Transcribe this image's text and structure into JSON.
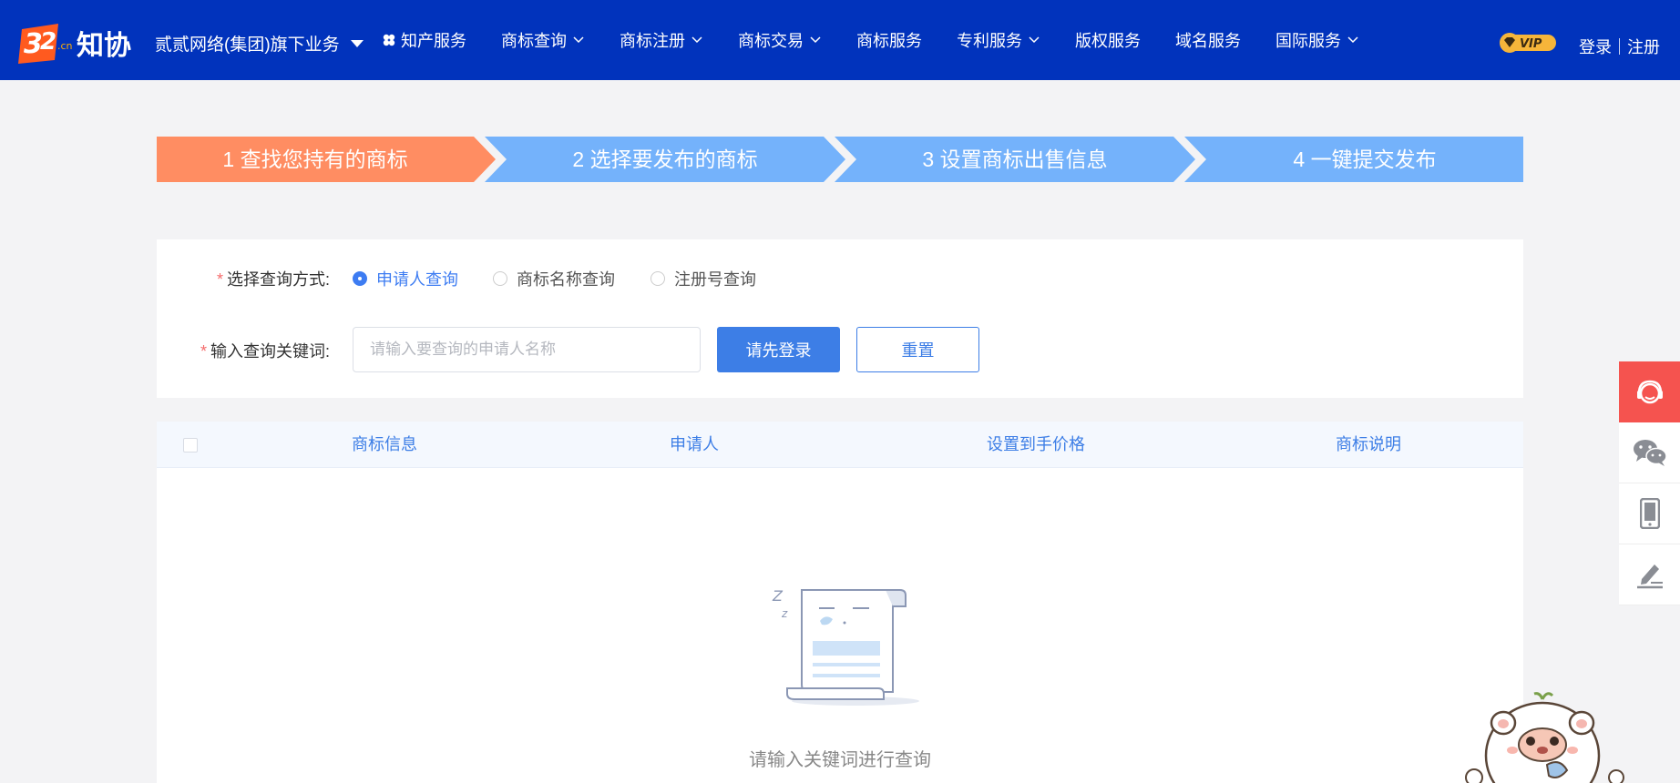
{
  "header": {
    "logo_text": "32.cn知协",
    "business_label": "贰贰网络(集团)旗下业务",
    "nav": [
      {
        "label": "知产服务",
        "icon": "clover-icon",
        "dropdown": false
      },
      {
        "label": "商标查询",
        "dropdown": true
      },
      {
        "label": "商标注册",
        "dropdown": true
      },
      {
        "label": "商标交易",
        "dropdown": true
      },
      {
        "label": "商标服务",
        "dropdown": false
      },
      {
        "label": "专利服务",
        "dropdown": true
      },
      {
        "label": "版权服务",
        "dropdown": false
      },
      {
        "label": "域名服务",
        "dropdown": false
      },
      {
        "label": "国际服务",
        "dropdown": true
      }
    ],
    "vip_label": "VIP",
    "login_label": "登录",
    "register_label": "注册"
  },
  "steps": [
    {
      "label": "1 查找您持有的商标",
      "active": true
    },
    {
      "label": "2 选择要发布的商标",
      "active": false
    },
    {
      "label": "3 设置商标出售信息",
      "active": false
    },
    {
      "label": "4 一键提交发布",
      "active": false
    }
  ],
  "form": {
    "query_mode_label": "选择查询方式:",
    "query_modes": [
      "申请人查询",
      "商标名称查询",
      "注册号查询"
    ],
    "selected_mode": "申请人查询",
    "keyword_label": "输入查询关键词:",
    "keyword_placeholder": "请输入要查询的申请人名称",
    "keyword_value": "",
    "submit_label": "请先登录",
    "reset_label": "重置"
  },
  "table": {
    "columns": [
      "商标信息",
      "申请人",
      "设置到手价格",
      "商标说明"
    ],
    "rows": [],
    "empty_text": "请输入关键词进行查询"
  },
  "sidebar": {
    "items": [
      "customer-service-icon",
      "wechat-icon",
      "mobile-icon",
      "feedback-icon"
    ]
  },
  "colors": {
    "header_bg": "#0133bc",
    "step_active": "#ff8d62",
    "step_inactive": "#74b2fb",
    "primary": "#3d7ee6",
    "side_active": "#f5534f"
  }
}
